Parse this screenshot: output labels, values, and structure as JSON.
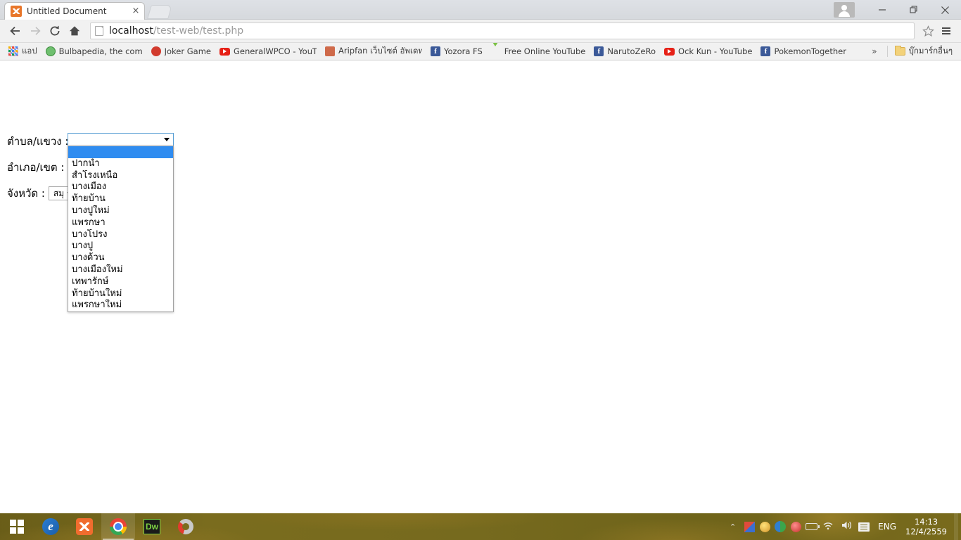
{
  "window": {
    "title": "Untitled Document",
    "controls": {
      "avatar": "profile-avatar",
      "minimize": "—",
      "maximize": "❐",
      "close": "✕"
    }
  },
  "tab": {
    "title": "Untitled Document",
    "close_label": "×",
    "favicon": "xampp-icon",
    "new_tab_label": "+"
  },
  "toolbar": {
    "back": "←",
    "forward": "→",
    "reload": "↻",
    "home": "⌂",
    "url_host": "localhost",
    "url_path": "/test-web/test.php",
    "url_full": "localhost/test-web/test.php",
    "star": "☆",
    "menu": "≡"
  },
  "bookmarks": {
    "items": [
      {
        "label": "แอป",
        "icon": "apps-grid-icon"
      },
      {
        "label": "Bulbapedia, the comm",
        "icon": "bulbapedia-icon"
      },
      {
        "label": "Joker Game",
        "icon": "joker-game-icon"
      },
      {
        "label": "GeneralWPCO - YouTu",
        "icon": "youtube-icon"
      },
      {
        "label": "Aripfan เว็บไซต์ อัพเดท",
        "icon": "aripfan-icon"
      },
      {
        "label": "Yozora FS",
        "icon": "facebook-icon"
      },
      {
        "label": "Free Online YouTube",
        "icon": "download-icon"
      },
      {
        "label": "NarutoZeRo",
        "icon": "facebook-icon"
      },
      {
        "label": "Ock Kun - YouTube",
        "icon": "youtube-icon"
      },
      {
        "label": "PokemonTogether",
        "icon": "facebook-icon"
      }
    ],
    "overflow": "»",
    "other_bookmarks": {
      "label": "บุ๊กมาร์กอื่นๆ",
      "icon": "folder-icon"
    }
  },
  "page": {
    "rows": [
      {
        "label": "ตำบล/แขวง :",
        "name": "tambon"
      },
      {
        "label": "อำเภอ/เขต :",
        "name": "ampur"
      },
      {
        "label": "จังหวัด :",
        "name": "province"
      }
    ],
    "tambon_select": {
      "value": "",
      "expanded": true,
      "selected_index": 0,
      "options": [
        "",
        "ปากน้ำ",
        "สำโรงเหนือ",
        "บางเมือง",
        "ท้ายบ้าน",
        "บางปูใหม่",
        "แพรกษา",
        "บางโปรง",
        "บางปู",
        "บางด้วน",
        "บางเมืองใหม่",
        "เทพารักษ์",
        "ท้ายบ้านใหม่",
        "แพรกษาใหม่"
      ]
    },
    "ampur_select": {
      "value": ""
    },
    "province_select": {
      "value": "สมุท"
    }
  },
  "taskbar": {
    "start": "windows-start-icon",
    "items": [
      {
        "name": "edge",
        "icon": "edge-icon"
      },
      {
        "name": "xampp",
        "icon": "xampp-icon"
      },
      {
        "name": "chrome",
        "icon": "chrome-icon"
      },
      {
        "name": "dreamweaver",
        "icon": "dreamweaver-icon"
      },
      {
        "name": "app-6",
        "icon": "app-icon"
      }
    ],
    "tray": {
      "chevron": "⌃",
      "icons": [
        "tray-icon-1",
        "tray-icon-2",
        "tray-icon-3",
        "tray-icon-4",
        "battery-icon",
        "wifi-icon",
        "volume-icon",
        "action-center-icon"
      ],
      "wifi": "◰",
      "volume": "🔊",
      "language": "ENG",
      "time": "14:13",
      "date": "12/4/2559"
    }
  },
  "colors": {
    "select_highlight": "#2f8cf0",
    "select_border": "#5a9fd4",
    "toolbar_bg": "#f1f1f1",
    "taskbar_bg": "#7a6c1e",
    "accent_orange": "#e8762a"
  }
}
